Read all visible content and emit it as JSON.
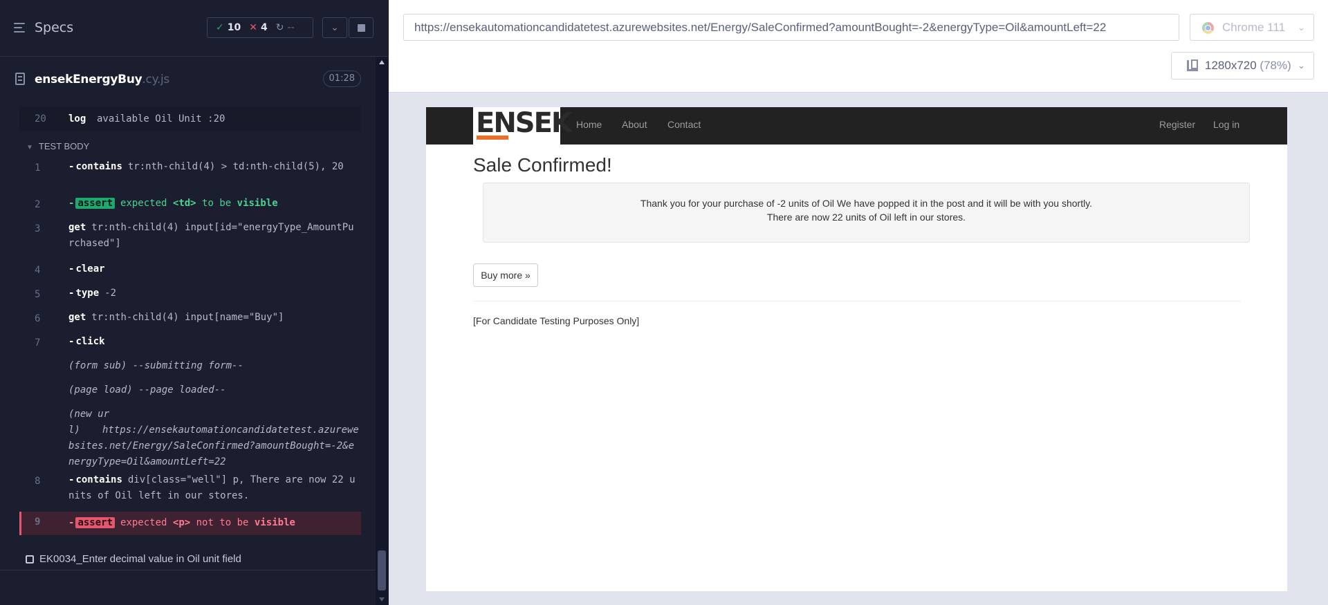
{
  "reporter": {
    "title": "Specs",
    "stats": {
      "passed": "10",
      "failed": "4",
      "pending": "--"
    },
    "spec": {
      "name": "ensekEnergyBuy",
      "ext": ".cy.js",
      "duration": "01:28"
    },
    "log_row": {
      "line": "20",
      "method": "log",
      "message": "available Oil Unit :20"
    },
    "test_body_label": "TEST BODY",
    "commands": [
      {
        "line": "1",
        "method": "contains",
        "text": "tr:nth-child(4) > td:nth-child(5), 20"
      },
      {
        "line": "2",
        "badge": "assert",
        "parts": [
          "expected",
          "<td>",
          "to be",
          "visible"
        ]
      },
      {
        "line": "3",
        "method": "get",
        "text": "tr:nth-child(4) input[id=\"energyType_AmountPurchased\"]"
      },
      {
        "line": "4",
        "method": "clear"
      },
      {
        "line": "5",
        "method": "type",
        "text": "-2"
      },
      {
        "line": "6",
        "method": "get",
        "text": "tr:nth-child(4) input[name=\"Buy\"]"
      },
      {
        "line": "7",
        "method": "click"
      },
      {
        "event": "(form sub)",
        "text": "--submitting form--"
      },
      {
        "event": "(page load)",
        "text": "--page loaded--"
      },
      {
        "event": "(new url)",
        "text": "https://ensekautomationcandidatetest.azurewebsites.net/Energy/SaleConfirmed?amountBought=-2&energyType=Oil&amountLeft=22"
      },
      {
        "line": "8",
        "method": "contains",
        "text": "div[class=\"well\"] p, There are now 22 units of Oil left in our stores."
      },
      {
        "line": "9",
        "badge": "assert",
        "parts": [
          "expected",
          "<p>",
          "not to be",
          "visible"
        ]
      }
    ],
    "next_test": "EK0034_Enter decimal value in Oil unit field"
  },
  "aut": {
    "url": "https://ensekautomationcandidatetest.azurewebsites.net/Energy/SaleConfirmed?amountBought=-2&energyType=Oil&amountLeft=22",
    "browser": "Chrome 111",
    "viewport": "1280x720",
    "zoom": "(78%)"
  },
  "page": {
    "logo": "ENSEK",
    "nav": {
      "home": "Home",
      "about": "About",
      "contact": "Contact",
      "register": "Register",
      "login": "Log in"
    },
    "heading": "Sale Confirmed!",
    "message_line1": "Thank you for your purchase of -2 units of Oil We have popped it in the post and it will be with you shortly.",
    "message_line2": "There are now 22 units of Oil left in our stores.",
    "buy_more": "Buy more »",
    "footer": "[For Candidate Testing Purposes Only]"
  },
  "colors": {
    "passed": "#1fa971",
    "failed": "#e45770",
    "brand_orange": "#e8702a",
    "reporter_bg": "#1b1e2e"
  }
}
